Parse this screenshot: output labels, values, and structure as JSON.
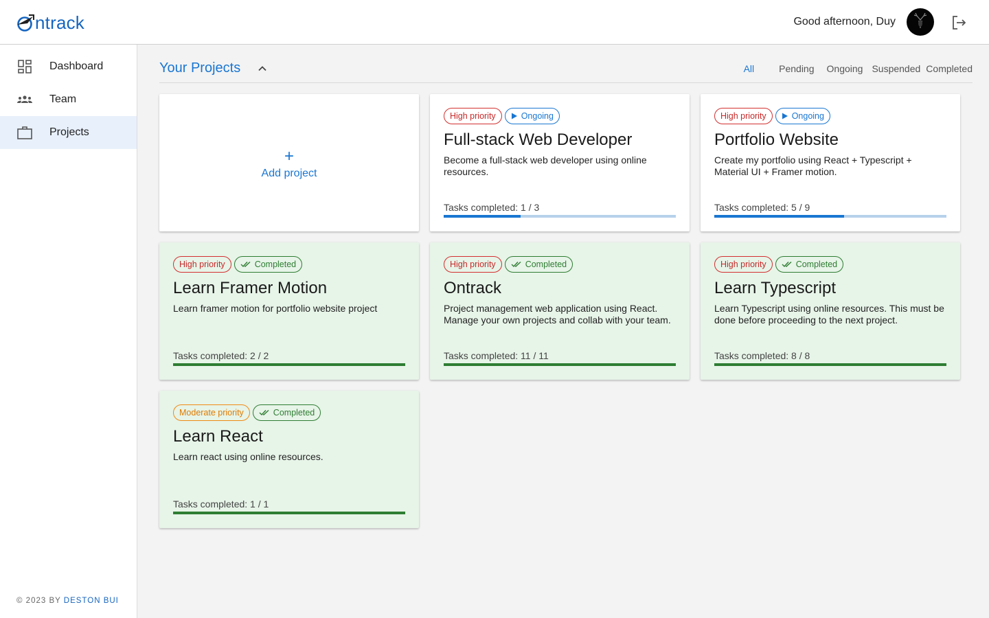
{
  "app": {
    "logo_text": "ntrack",
    "brand_color": "#1565c0",
    "accent": "#1976d2"
  },
  "header": {
    "greeting": "Good afternoon, Duy",
    "avatar_icon": "deer-avatar-icon",
    "logout_icon": "logout-icon"
  },
  "sidebar": {
    "items": [
      {
        "label": "Dashboard",
        "icon": "dashboard-icon",
        "active": false
      },
      {
        "label": "Team",
        "icon": "team-icon",
        "active": false
      },
      {
        "label": "Projects",
        "icon": "briefcase-icon",
        "active": true
      }
    ],
    "footer_prefix": "© 2023 BY ",
    "footer_author": "DESTON BUI"
  },
  "main": {
    "title": "Your Projects",
    "filters": [
      {
        "label": "All",
        "active": true
      },
      {
        "label": "Pending",
        "active": false
      },
      {
        "label": "Ongoing",
        "active": false
      },
      {
        "label": "Suspended",
        "active": false
      },
      {
        "label": "Completed",
        "active": false
      }
    ],
    "add_project": {
      "plus": "+",
      "label": "Add project"
    },
    "projects": [
      {
        "priority": "High priority",
        "status": "Ongoing",
        "title": "Full-stack Web Developer",
        "description": "Become a full-stack web developer using online resources.",
        "tasks_label": "Tasks completed: 1 / 3",
        "progress": 0.33
      },
      {
        "priority": "High priority",
        "status": "Ongoing",
        "title": "Portfolio Website",
        "description": "Create my portfolio using React + Typescript + Material UI + Framer motion.",
        "tasks_label": "Tasks completed: 5 / 9",
        "progress": 0.56
      },
      {
        "priority": "High priority",
        "status": "Completed",
        "title": "Learn Framer Motion",
        "description": "Learn framer motion for portfolio website project",
        "tasks_label": "Tasks completed: 2 / 2",
        "progress": 1
      },
      {
        "priority": "High priority",
        "status": "Completed",
        "title": "Ontrack",
        "description": "Project management web application using React. Manage your own projects and collab with your team.",
        "tasks_label": "Tasks completed: 11 / 11",
        "progress": 1
      },
      {
        "priority": "High priority",
        "status": "Completed",
        "title": "Learn Typescript",
        "description": "Learn Typescript using online resources. This must be done before proceeding to the next project.",
        "tasks_label": "Tasks completed: 8 / 8",
        "progress": 1
      },
      {
        "priority": "Moderate priority",
        "status": "Completed",
        "title": "Learn React",
        "description": "Learn react using online resources.",
        "tasks_label": "Tasks completed: 1 / 1",
        "progress": 1
      }
    ]
  }
}
